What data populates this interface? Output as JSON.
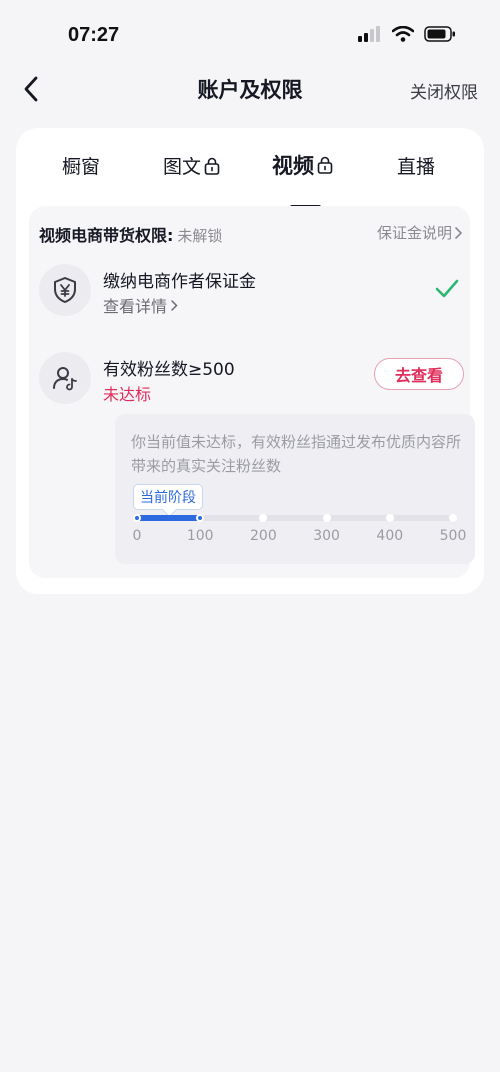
{
  "status_bar": {
    "time": "07:27",
    "icons": [
      "signal-icon",
      "wifi-icon",
      "battery-icon"
    ]
  },
  "nav": {
    "title": "账户及权限",
    "right_action": "关闭权限",
    "back_icon": "chevron-left-icon"
  },
  "tabs": [
    {
      "label": "橱窗",
      "locked": false,
      "active": false
    },
    {
      "label": "图文",
      "locked": true,
      "active": false
    },
    {
      "label": "视频",
      "locked": true,
      "active": true
    },
    {
      "label": "直播",
      "locked": false,
      "active": false
    }
  ],
  "permission": {
    "title": "视频电商带货权限:",
    "status": "未解锁",
    "link": "保证金说明",
    "requirements": [
      {
        "title": "缴纳电商作者保证金",
        "sub": "查看详情",
        "icon": "yuan-shield-icon",
        "done": true
      },
      {
        "title": "有效粉丝数≥500",
        "sub": "未达标",
        "icon": "user-music-icon",
        "done": false,
        "button": "去查看"
      }
    ],
    "progress": {
      "description": "你当前值未达标，有效粉丝指通过发布优质内容所带来的真实关注粉丝数",
      "stage_label": "当前阶段",
      "ticks": [
        "0",
        "100",
        "200",
        "300",
        "400",
        "500"
      ],
      "current_fraction": 0.2
    }
  },
  "colors": {
    "accent_red": "#e02e5b",
    "progress_blue": "#2d6ae0",
    "check_green": "#2bb673"
  }
}
